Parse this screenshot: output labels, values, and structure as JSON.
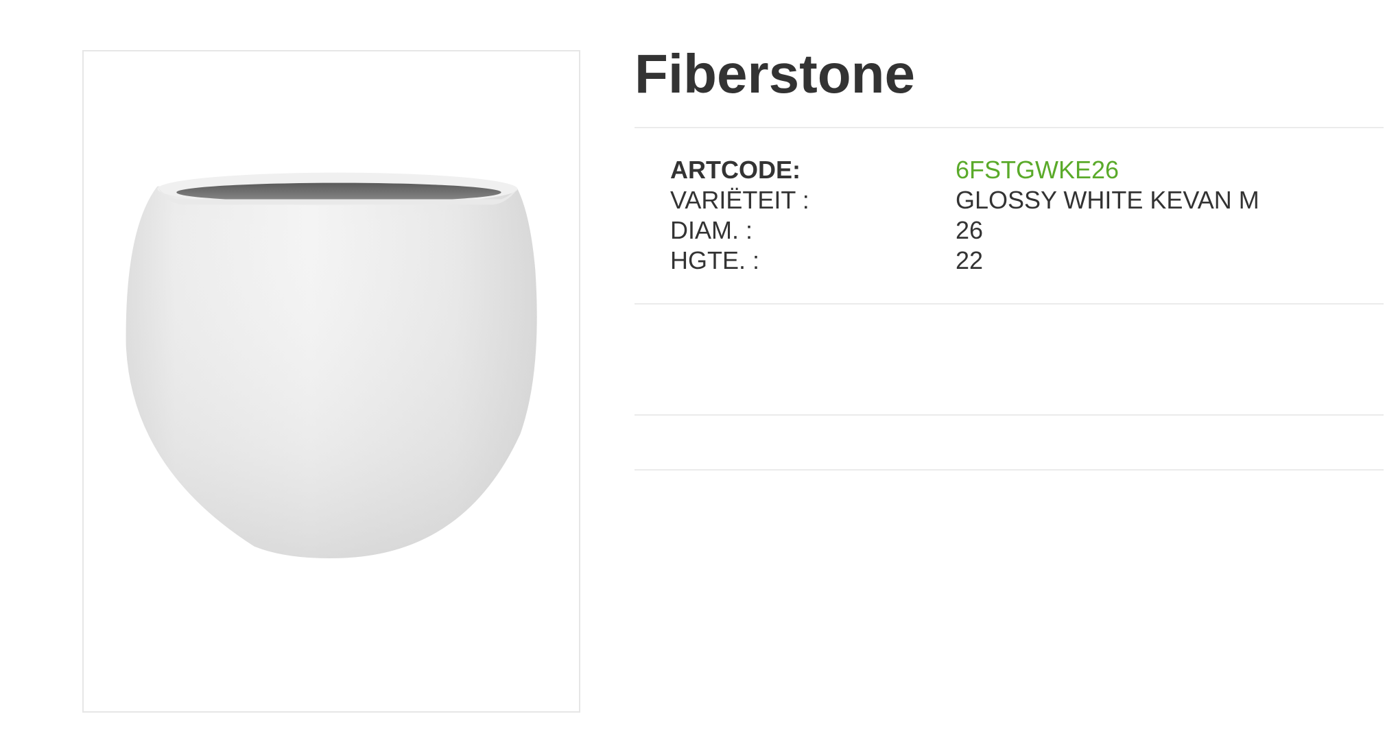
{
  "product": {
    "title": "Fiberstone",
    "image_alt": "glossy white round planter pot"
  },
  "specs": [
    {
      "label": "ARTCODE:",
      "value": "6FSTGWKE26"
    },
    {
      "label": "VARIËTEIT :",
      "value": "GLOSSY WHITE KEVAN M"
    },
    {
      "label": "DIAM. :",
      "value": "26"
    },
    {
      "label": "HGTE. :",
      "value": "22"
    }
  ],
  "colors": {
    "accent": "#5aaa2a",
    "text": "#333333",
    "divider": "#ebebeb"
  }
}
